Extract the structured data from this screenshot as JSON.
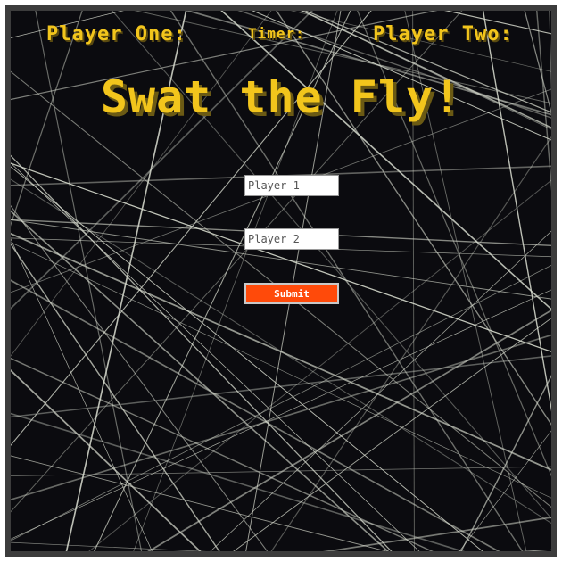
{
  "hud": {
    "player_one_label": "Player One:",
    "timer_label": "Timer:",
    "player_two_label": "Player Two:"
  },
  "title": "Swat the Fly!",
  "form": {
    "player1_placeholder": "Player 1",
    "player1_value": "",
    "player2_placeholder": "Player 2",
    "player2_value": "",
    "submit_label": "Submit"
  },
  "colors": {
    "background": "#0b0b0f",
    "accent_text": "#f2c51c",
    "submit_button": "#ff4a0a",
    "frame_border": "#3c3c3c",
    "web_lines": "#d8dccf"
  }
}
